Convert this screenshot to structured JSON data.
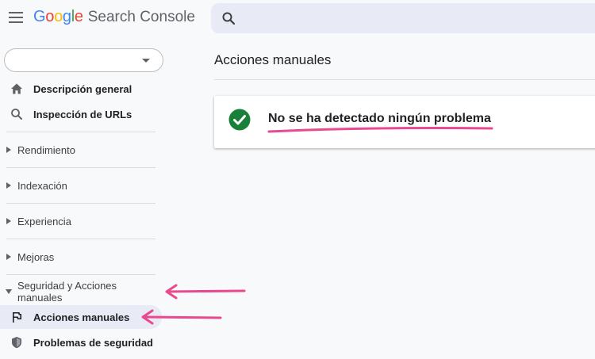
{
  "app": {
    "logo_letters": [
      {
        "ch": "G",
        "color": "#4285F4"
      },
      {
        "ch": "o",
        "color": "#EA4335"
      },
      {
        "ch": "o",
        "color": "#FBBC05"
      },
      {
        "ch": "g",
        "color": "#4285F4"
      },
      {
        "ch": "l",
        "color": "#34A853"
      },
      {
        "ch": "e",
        "color": "#EA4335"
      }
    ],
    "logo_text": "Google",
    "product_name": "Search Console"
  },
  "header": {
    "menu_icon": "hamburger-menu-icon",
    "search_icon": "search-icon",
    "search_value": "",
    "search_placeholder": ""
  },
  "sidebar": {
    "property_value": "",
    "top_items": [
      {
        "label": "Descripción general",
        "icon": "home-icon"
      },
      {
        "label": "Inspección de URLs",
        "icon": "search-icon"
      }
    ],
    "sections": [
      {
        "label": "Rendimiento",
        "expanded": false
      },
      {
        "label": "Indexación",
        "expanded": false
      },
      {
        "label": "Experiencia",
        "expanded": false
      },
      {
        "label": "Mejoras",
        "expanded": false
      },
      {
        "label": "Seguridad y Acciones manuales",
        "expanded": true
      }
    ],
    "sub_items": [
      {
        "label": "Acciones manuales",
        "icon": "flag-icon",
        "active": true
      },
      {
        "label": "Problemas de seguridad",
        "icon": "shield-icon",
        "active": false
      }
    ]
  },
  "main": {
    "page_title": "Acciones manuales",
    "status_text": "No se ha detectado ningún problema",
    "status_icon": "check-circle-icon"
  },
  "colors": {
    "accent": "#e8eaf6",
    "success": "#188038",
    "annotation": "#e8498f"
  }
}
